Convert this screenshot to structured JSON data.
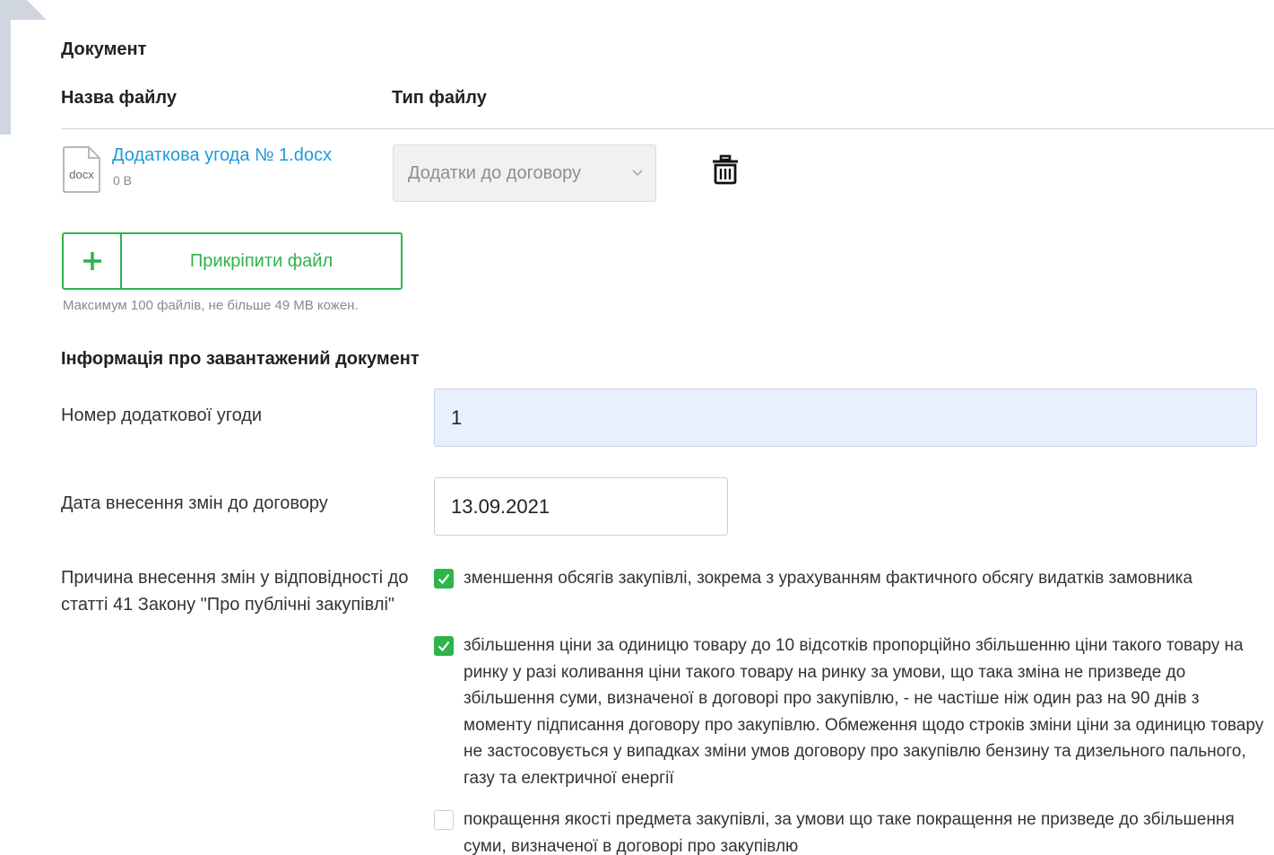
{
  "document": {
    "section_title": "Документ",
    "columns": {
      "name": "Назва файлу",
      "type": "Тип файлу"
    },
    "file": {
      "icon_text": "docx",
      "name": "Додаткова угода № 1.docx",
      "size": "0 B",
      "type_selected": "Додатки до договору"
    },
    "attach_button_label": "Прикріпити файл",
    "hint": "Максимум 100 файлів, не більше 49 MB кожен."
  },
  "info": {
    "title": "Інформація про завантажений документ",
    "number_label": "Номер додаткової угоди",
    "number_value": "1",
    "date_label": "Дата внесення змін до договору",
    "date_value": "13.09.2021",
    "reason_label": "Причина внесення змін у відповідності до статті 41 Закону \"Про публічні закупівлі\"",
    "reasons": [
      {
        "text": "зменшення обсягів закупівлі, зокрема з урахуванням фактичного обсягу видатків замовника",
        "checked": true
      },
      {
        "text": "збільшення ціни за одиницю товару до 10 відсотків пропорційно збільшенню ціни такого товару на ринку у разі коливання ціни такого товару на ринку за умови, що така зміна не призведе до збільшення суми, визначеної в договорі про закупівлю, - не частіше ніж один раз на 90 днів з моменту підписання договору про закупівлю. Обмеження щодо строків зміни ціни за одиницю товару не застосовується у випадках зміни умов договору про закупівлю бензину та дизельного пального, газу та електричної енергії",
        "checked": true
      },
      {
        "text": "покращення якості предмета закупівлі, за умови що таке покращення не призведе до збільшення суми, визначеної в договорі про закупівлю",
        "checked": false
      }
    ]
  },
  "colors": {
    "accent_green": "#2db44b",
    "link_blue": "#1e9bd7",
    "autofill_bg": "#e8f0fe"
  },
  "icons": {
    "file": "docx-file-icon",
    "select": "chevron-down-icon",
    "delete": "trash-icon",
    "add": "plus-icon",
    "check": "check-icon"
  }
}
